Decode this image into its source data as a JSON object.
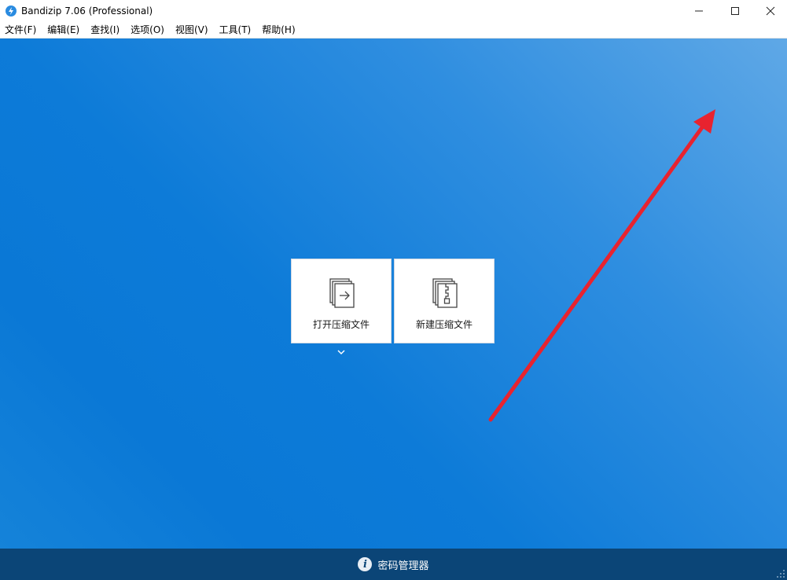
{
  "window": {
    "title": "Bandizip 7.06 (Professional)"
  },
  "menu": [
    {
      "label": "文件(F)"
    },
    {
      "label": "编辑(E)"
    },
    {
      "label": "查找(I)"
    },
    {
      "label": "选项(O)"
    },
    {
      "label": "视图(V)"
    },
    {
      "label": "工具(T)"
    },
    {
      "label": "帮助(H)"
    }
  ],
  "actions": {
    "open_archive": "打开压缩文件",
    "new_archive": "新建压缩文件"
  },
  "footer": {
    "password_manager": "密码管理器"
  },
  "icons": {
    "app": "bandizip-logo-icon",
    "open": "open-archive-icon",
    "new": "new-archive-icon",
    "info": "info-icon",
    "annotation": "red-arrow-annotation"
  },
  "colors": {
    "accent": "#0a78d6",
    "footer": "#0b4577",
    "annotation": "#e8232f"
  }
}
